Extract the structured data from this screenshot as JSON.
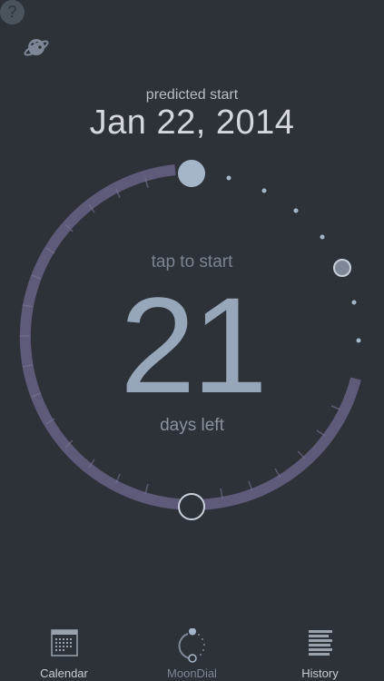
{
  "header": {
    "subtitle": "predicted start",
    "date": "Jan 22, 2014",
    "help_glyph": "?"
  },
  "dial": {
    "tap_text": "tap to start",
    "days_left": "21",
    "days_label": "days left",
    "ring_color": "#5e5a79",
    "knob_color": "#a6b6c9",
    "accent": "#98a6b9"
  },
  "icons": {
    "theme": "planet-palette-icon",
    "help": "question-icon"
  },
  "tabs": [
    {
      "label": "Calendar",
      "icon": "calendar-icon",
      "active": false
    },
    {
      "label": "MoonDial",
      "icon": "moondial-icon",
      "active": true
    },
    {
      "label": "History",
      "icon": "history-icon",
      "active": false
    }
  ]
}
